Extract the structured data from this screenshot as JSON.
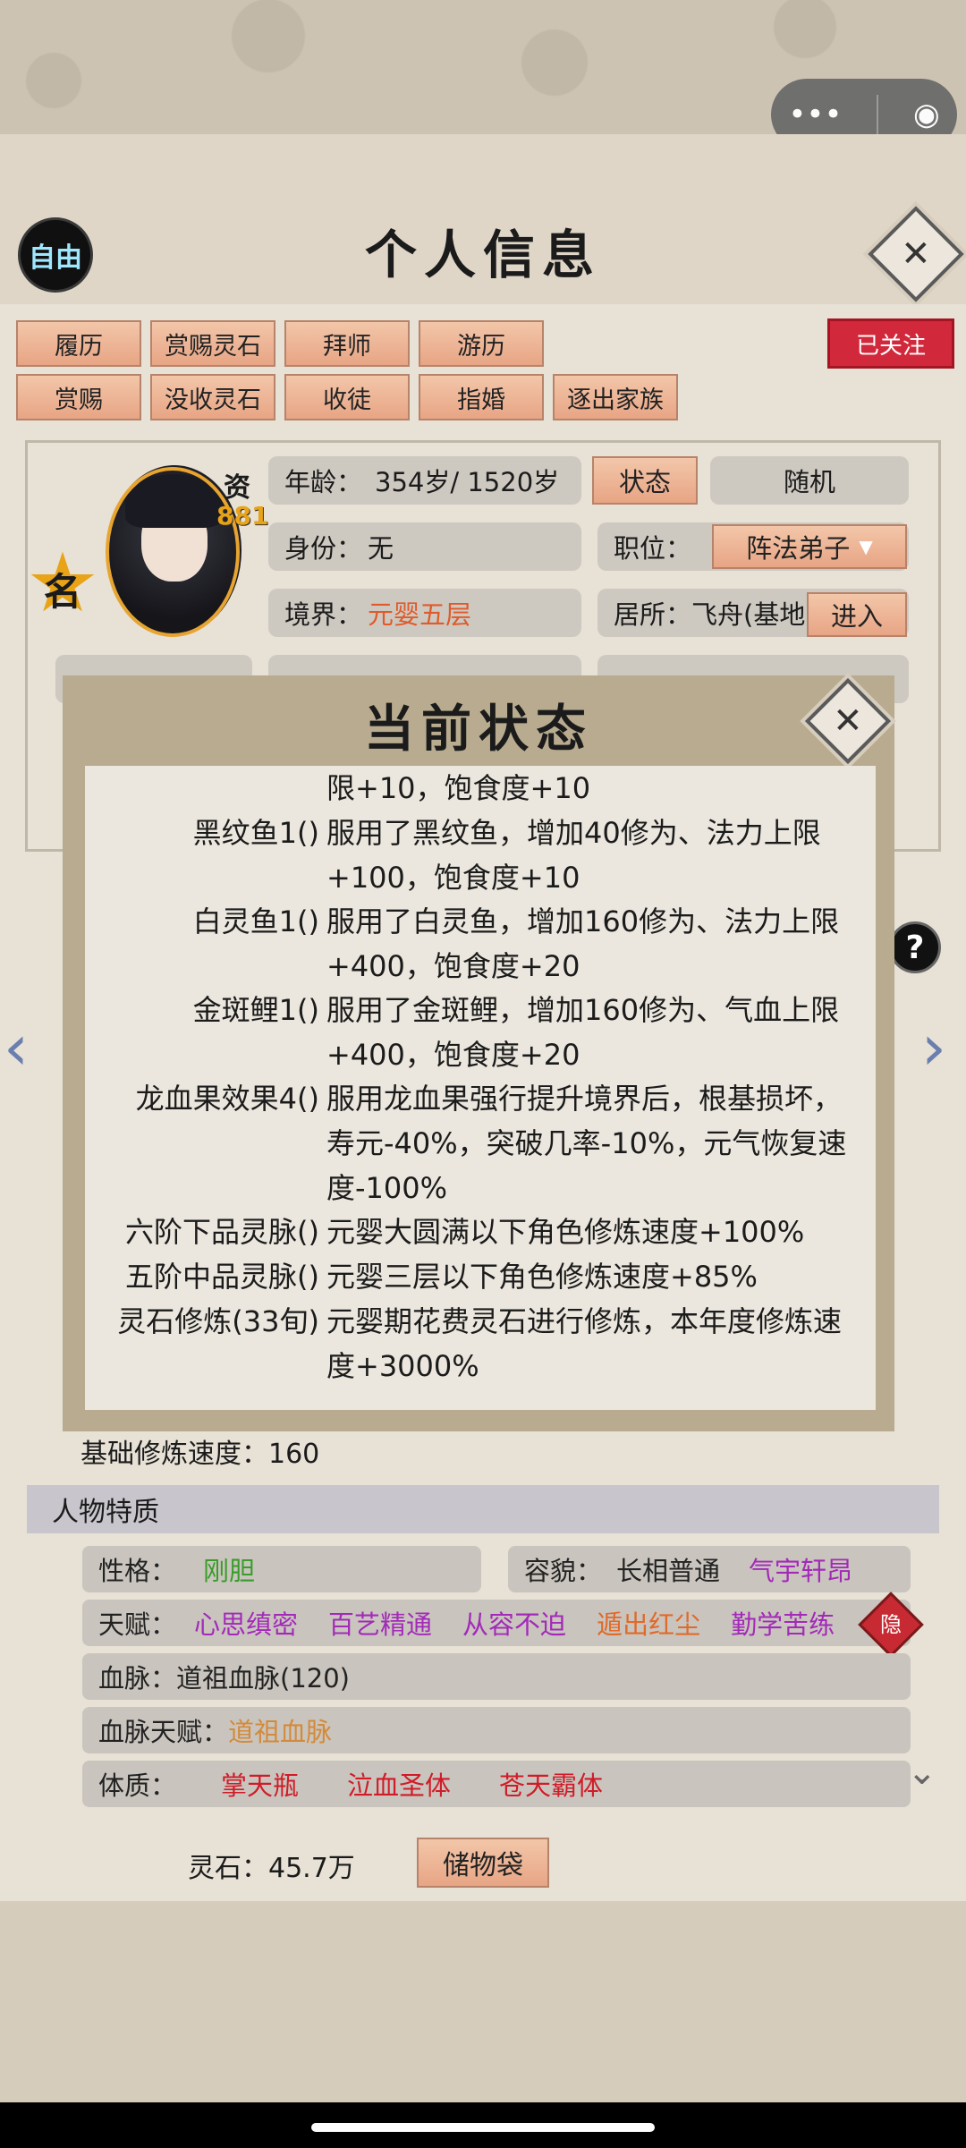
{
  "header": {
    "title": "个人信息",
    "auto_label": "自由",
    "close_label": "✕"
  },
  "miniapp": {
    "more_label": "•••",
    "target_label": "◉"
  },
  "actions": {
    "row1": [
      "履历",
      "赏赐灵石",
      "拜师",
      "游历"
    ],
    "row2": [
      "赏赐",
      "没收灵石",
      "收徒",
      "指婚",
      "逐出家族"
    ],
    "follow": "已关注"
  },
  "profile": {
    "zi": "资",
    "zi_value": "881",
    "fame_char": "名",
    "age_label": "年龄：",
    "age_value": "354岁/ 1520岁",
    "status_button": "状态",
    "random_button": "随机",
    "identity_label": "身份：",
    "identity_value": "无",
    "position_label": "职位：",
    "position_value": "阵法弟子",
    "realm_label": "境界：",
    "realm_value": "元婴五层",
    "residence_label": "居所：",
    "residence_value": "飞舟(基地",
    "enter_button": "进入"
  },
  "popup": {
    "title": "当前状态",
    "close_label": "✕",
    "rows": [
      {
        "name": "",
        "desc": "限+10，饱食度+10"
      },
      {
        "name": "黑纹鱼1()",
        "desc": "服用了黑纹鱼，增加40修为、法力上限+100，饱食度+10"
      },
      {
        "name": "白灵鱼1()",
        "desc": "服用了白灵鱼，增加160修为、法力上限+400，饱食度+20"
      },
      {
        "name": "金斑鲤1()",
        "desc": "服用了金斑鲤，增加160修为、气血上限+400，饱食度+20"
      },
      {
        "name": "龙血果效果4()",
        "desc": "服用龙血果强行提升境界后，根基损坏，寿元-40%，突破几率-10%，元气恢复速度-100%"
      },
      {
        "name": "六阶下品灵脉()",
        "desc": "元婴大圆满以下角色修炼速度+100%"
      },
      {
        "name": "五阶中品灵脉()",
        "desc": "元婴三层以下角色修炼速度+85%"
      },
      {
        "name": "灵石修炼(33旬)",
        "desc": "元婴期花费灵石进行修炼，本年度修炼速度+3000%"
      }
    ]
  },
  "base_speed": "基础修炼速度：160",
  "traits": {
    "section_title": "人物特质",
    "personality_label": "性格：",
    "personality_value": "刚胆",
    "looks_label": "容貌：",
    "looks_value1": "长相普通",
    "looks_value2": "气宇轩昂",
    "talent_label": "天赋：",
    "talents": [
      "心思缜密",
      "百艺精通",
      "从容不迫",
      "遁出红尘",
      "勤学苦练"
    ],
    "hide_label": "隐",
    "bloodline_label": "血脉：",
    "bloodline_value": "道祖血脉(120)",
    "bloodline_talent_label": "血脉天赋：",
    "bloodline_talent_value": "道祖血脉",
    "physique_label": "体质：",
    "physiques": [
      "掌天瓶",
      "泣血圣体",
      "苍天霸体"
    ]
  },
  "footer": {
    "spirit_stone": "灵石：45.7万",
    "bag_button": "储物袋"
  },
  "colors": {
    "accent_red": "#d2283b",
    "button_peach": "#e7a585",
    "realm_orange": "#e05a2a"
  }
}
